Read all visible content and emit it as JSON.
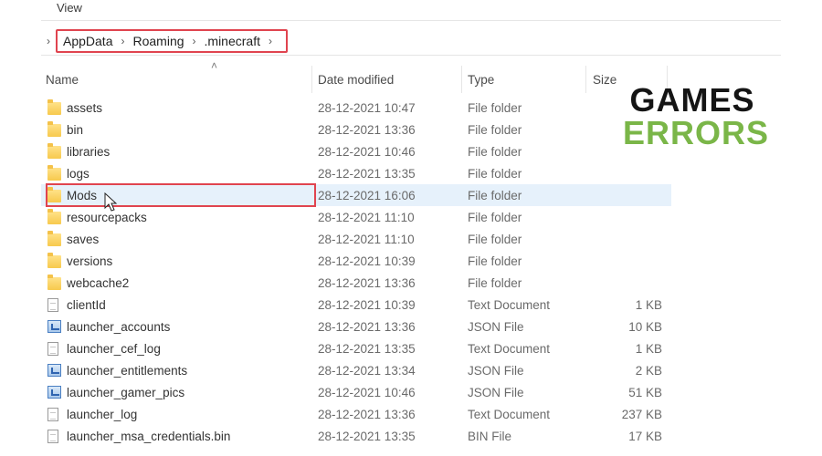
{
  "menu": {
    "view_label": "View"
  },
  "breadcrumb": [
    {
      "label": "AppData"
    },
    {
      "label": "Roaming"
    },
    {
      "label": ".minecraft"
    }
  ],
  "columns": {
    "name": "Name",
    "date": "Date modified",
    "type": "Type",
    "size": "Size"
  },
  "files": [
    {
      "name": "assets",
      "date": "28-12-2021 10:47",
      "type": "File folder",
      "size": "",
      "icon": "folder-icon"
    },
    {
      "name": "bin",
      "date": "28-12-2021 13:36",
      "type": "File folder",
      "size": "",
      "icon": "folder-icon"
    },
    {
      "name": "libraries",
      "date": "28-12-2021 10:46",
      "type": "File folder",
      "size": "",
      "icon": "folder-icon"
    },
    {
      "name": "logs",
      "date": "28-12-2021 13:35",
      "type": "File folder",
      "size": "",
      "icon": "folder-icon"
    },
    {
      "name": "Mods",
      "date": "28-12-2021 16:06",
      "type": "File folder",
      "size": "",
      "icon": "folder-icon",
      "highlighted": true
    },
    {
      "name": "resourcepacks",
      "date": "28-12-2021 11:10",
      "type": "File folder",
      "size": "",
      "icon": "folder-icon"
    },
    {
      "name": "saves",
      "date": "28-12-2021 11:10",
      "type": "File folder",
      "size": "",
      "icon": "folder-icon"
    },
    {
      "name": "versions",
      "date": "28-12-2021 10:39",
      "type": "File folder",
      "size": "",
      "icon": "folder-icon"
    },
    {
      "name": "webcache2",
      "date": "28-12-2021 13:36",
      "type": "File folder",
      "size": "",
      "icon": "folder-icon"
    },
    {
      "name": "clientId",
      "date": "28-12-2021 10:39",
      "type": "Text Document",
      "size": "1 KB",
      "icon": "text-document-icon"
    },
    {
      "name": "launcher_accounts",
      "date": "28-12-2021 13:36",
      "type": "JSON File",
      "size": "10 KB",
      "icon": "json-file-icon"
    },
    {
      "name": "launcher_cef_log",
      "date": "28-12-2021 13:35",
      "type": "Text Document",
      "size": "1 KB",
      "icon": "text-document-icon"
    },
    {
      "name": "launcher_entitlements",
      "date": "28-12-2021 13:34",
      "type": "JSON File",
      "size": "2 KB",
      "icon": "json-file-icon"
    },
    {
      "name": "launcher_gamer_pics",
      "date": "28-12-2021 10:46",
      "type": "JSON File",
      "size": "51 KB",
      "icon": "json-file-icon"
    },
    {
      "name": "launcher_log",
      "date": "28-12-2021 13:36",
      "type": "Text Document",
      "size": "237 KB",
      "icon": "text-document-icon"
    },
    {
      "name": "launcher_msa_credentials.bin",
      "date": "28-12-2021 13:35",
      "type": "BIN File",
      "size": "17 KB",
      "icon": "bin-file-icon"
    }
  ],
  "logo": {
    "line1": "GAMES",
    "line2": "ERRORS",
    "color1": "#151515",
    "color2": "#7ab648"
  },
  "colors": {
    "annotation": "#e0444f",
    "row_highlight": "#e6f1fb",
    "folder": "#f7c94d"
  }
}
